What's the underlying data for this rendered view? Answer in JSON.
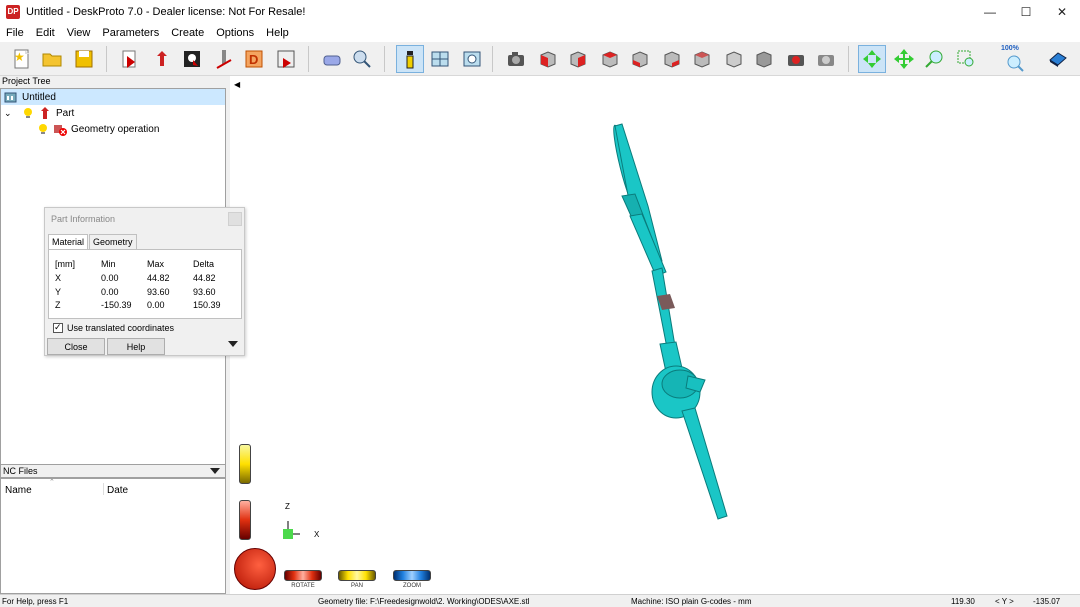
{
  "window": {
    "title": "Untitled - DeskProto 7.0 - Dealer license: Not For Resale!",
    "icon_text": "DP",
    "minimize": "—",
    "maximize": "☐",
    "close": "✕"
  },
  "menu": [
    "File",
    "Edit",
    "View",
    "Parameters",
    "Create",
    "Options",
    "Help"
  ],
  "toolbar": {
    "zoom_label": "100%"
  },
  "project_tree": {
    "header": "Project Tree",
    "project": "Untitled",
    "part": "Part",
    "operation": "Geometry operation"
  },
  "nc_files": {
    "header": "NC Files",
    "columns": [
      "Name",
      "Date"
    ]
  },
  "part_info": {
    "title": "Part Information",
    "tabs": [
      "Material",
      "Geometry"
    ],
    "columns": [
      "[mm]",
      "Min",
      "Max",
      "Delta"
    ],
    "rows": [
      {
        "axis": "X",
        "min": "0.00",
        "max": "44.82",
        "delta": "44.82"
      },
      {
        "axis": "Y",
        "min": "0.00",
        "max": "93.60",
        "delta": "93.60"
      },
      {
        "axis": "Z",
        "min": "-150.39",
        "max": "0.00",
        "delta": "150.39"
      }
    ],
    "checkbox_label": "Use translated coordinates",
    "close_button": "Close",
    "help_button": "Help"
  },
  "viewport": {
    "axis_z": "Z",
    "axis_x": "X",
    "model_color": "#1ac6c6",
    "rotate_label": "ROTATE",
    "pan_label": "PAN",
    "zoom_label": "ZOOM"
  },
  "status": {
    "help": "For Help, press F1",
    "geometry_file": "Geometry file: F:\\Freedesignwold\\2. Working\\ODES\\AXE.stl",
    "machine": "Machine: ISO plain G-codes - mm",
    "coord_value": "119.30",
    "coord_axis": "< Y >",
    "coord_value2": "-135.07"
  }
}
